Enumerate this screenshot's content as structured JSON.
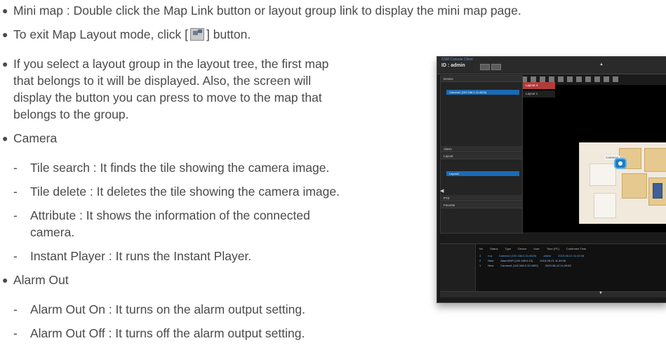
{
  "doc": {
    "items": [
      {
        "text": "Mini map : Double click the Map Link button or layout group link to display the mini map page."
      },
      {
        "text_before_icon": "To exit Map Layout mode, click [",
        "text_after_icon": "] button."
      },
      {
        "lines": [
          "If you select a layout group in the layout tree, the first map",
          "that belongs to it will be displayed. Also, the screen will",
          "display the button you can press to move to the map that",
          "belongs to the group."
        ]
      },
      {
        "text": "Camera"
      },
      {
        "text": "Tile search : It finds the tile showing the camera image."
      },
      {
        "text": "Tile delete : It deletes the tile showing the camera image."
      },
      {
        "lines": [
          "Attribute : It shows the information of the connected",
          "camera."
        ]
      },
      {
        "text": "Instant Player : It runs the Instant Player."
      },
      {
        "text": "Alarm Out"
      },
      {
        "text": "Alarm Out On : It turns on the alarm output setting."
      },
      {
        "text": "Alarm Out Off : It turns off the alarm output setting."
      }
    ]
  },
  "screenshot": {
    "app_title": "SSM Console Client",
    "user": "ID : admin",
    "left_panel": {
      "device": "Device",
      "alarm": "Alarm",
      "layout": "Layout",
      "ptz": "PTZ",
      "favorite": "Favorite",
      "selected_camera": "Camera1 (192.168.1.11:4520)",
      "layout_item": "Layout1"
    },
    "layouts": [
      "Layout 4",
      "Layout 1"
    ],
    "camera_label": "Camera1",
    "table": {
      "headers": [
        "No",
        "Status",
        "Type",
        "Device",
        "User",
        "Time (PC)",
        "Confirmed Time"
      ],
      "rows": [
        [
          "3",
          "Inq",
          "",
          "Camera1 (192.168.0.21:4520)",
          "admin",
          "2019-08-21 11:49:28",
          ""
        ],
        [
          "2",
          "New",
          "",
          "AlarmNVR (192.168.0.12)",
          "",
          "2019-08-21 11:49:28",
          ""
        ],
        [
          "1",
          "New",
          "",
          "Camera1 (192.168.0.12:4320)",
          "",
          "2019-08-12 11:49:53",
          ""
        ]
      ]
    }
  }
}
